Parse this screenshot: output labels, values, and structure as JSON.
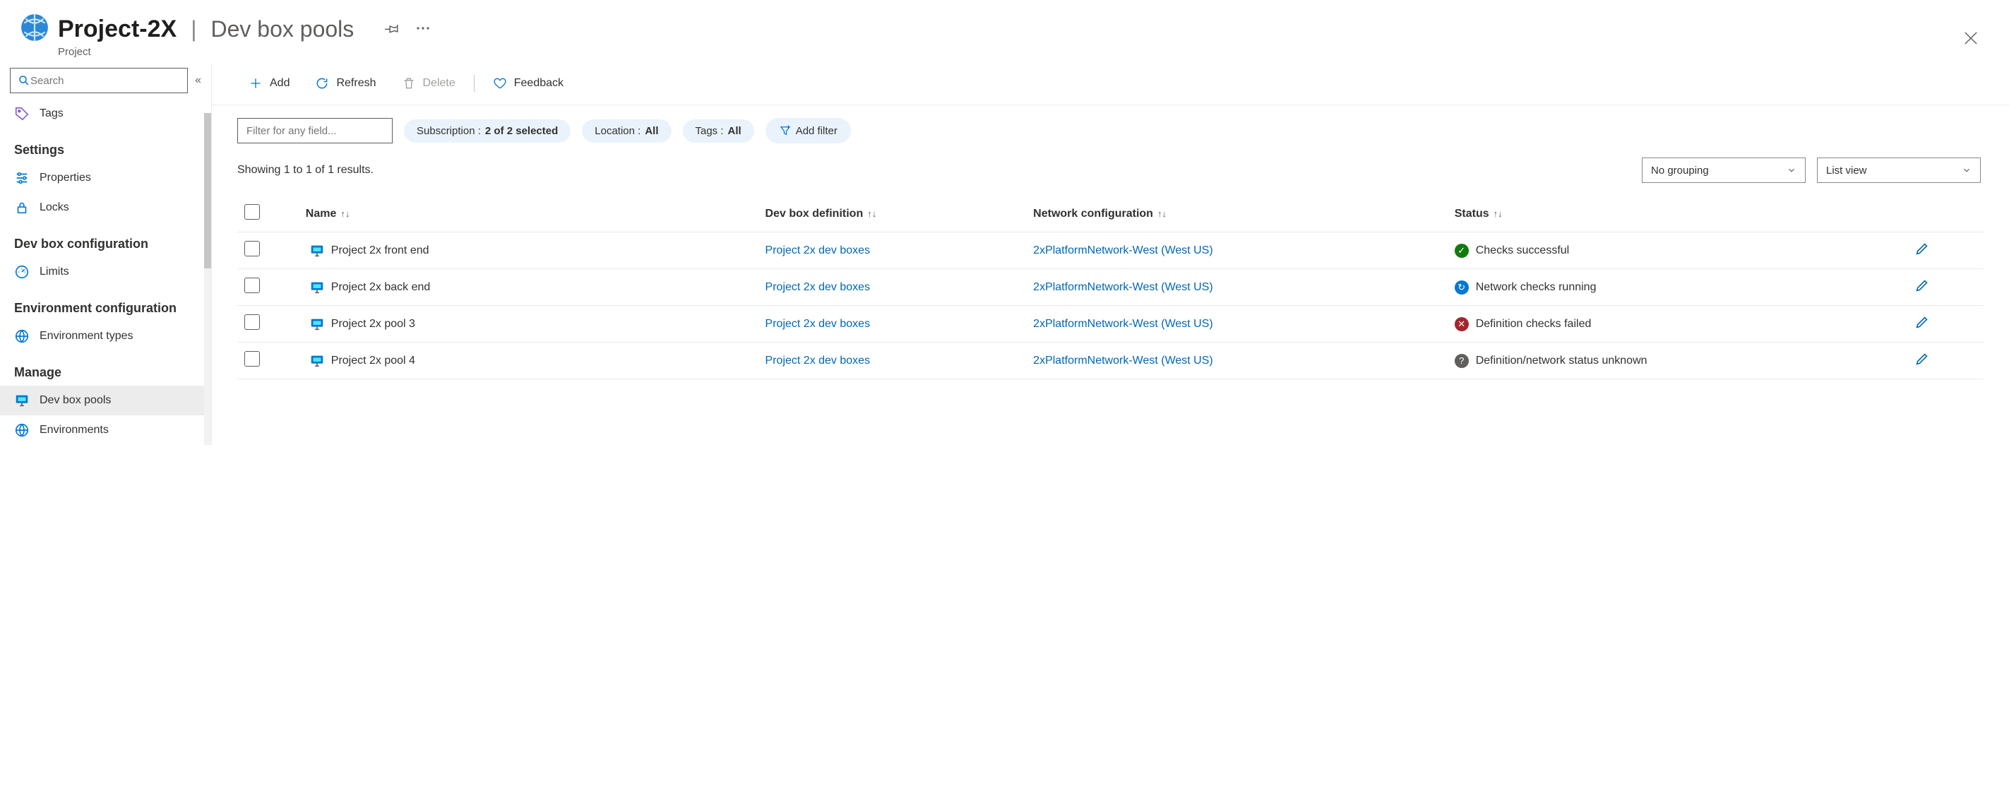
{
  "header": {
    "project_name": "Project-2X",
    "section_title": "Dev box pools",
    "subtitle": "Project"
  },
  "sidebar": {
    "search_placeholder": "Search",
    "items_top": [
      {
        "icon": "tag",
        "label": "Tags"
      }
    ],
    "groups": [
      {
        "title": "Settings",
        "items": [
          {
            "icon": "sliders",
            "label": "Properties"
          },
          {
            "icon": "lock",
            "label": "Locks"
          }
        ]
      },
      {
        "title": "Dev box configuration",
        "items": [
          {
            "icon": "gauge",
            "label": "Limits"
          }
        ]
      },
      {
        "title": "Environment configuration",
        "items": [
          {
            "icon": "env-type",
            "label": "Environment types"
          }
        ]
      },
      {
        "title": "Manage",
        "items": [
          {
            "icon": "monitor",
            "label": "Dev box pools",
            "active": true
          },
          {
            "icon": "globe",
            "label": "Environments"
          }
        ]
      }
    ]
  },
  "toolbar": {
    "add": "Add",
    "refresh": "Refresh",
    "delete": "Delete",
    "feedback": "Feedback"
  },
  "filters": {
    "field_placeholder": "Filter for any field...",
    "subscription_label": "Subscription : ",
    "subscription_value": "2 of 2 selected",
    "location_label": "Location : ",
    "location_value": "All",
    "tags_label": "Tags : ",
    "tags_value": "All",
    "add_filter": "Add filter"
  },
  "results": {
    "text": "Showing 1 to 1 of 1 results.",
    "grouping": "No grouping",
    "view": "List view"
  },
  "columns": {
    "name": "Name",
    "definition": "Dev box definition",
    "network": "Network configuration",
    "status": "Status"
  },
  "rows": [
    {
      "name": "Project 2x front end",
      "definition": "Project 2x dev boxes",
      "network": "2xPlatformNetwork-West (West US)",
      "status_kind": "ok",
      "status_text": "Checks successful"
    },
    {
      "name": "Project 2x back end",
      "definition": "Project 2x dev boxes",
      "network": "2xPlatformNetwork-West (West US)",
      "status_kind": "run",
      "status_text": "Network checks running"
    },
    {
      "name": "Project 2x pool 3",
      "definition": "Project 2x dev boxes",
      "network": "2xPlatformNetwork-West (West US)",
      "status_kind": "fail",
      "status_text": "Definition checks failed"
    },
    {
      "name": "Project 2x pool 4",
      "definition": "Project 2x dev boxes",
      "network": "2xPlatformNetwork-West (West US)",
      "status_kind": "unk",
      "status_text": "Definition/network status unknown"
    }
  ]
}
